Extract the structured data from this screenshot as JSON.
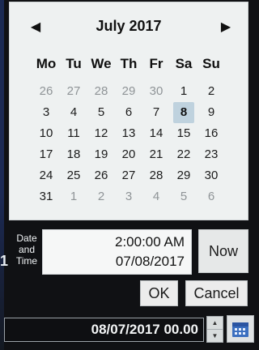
{
  "calendar": {
    "month_title": "July 2017",
    "prev_icon": "◀",
    "next_icon": "▶",
    "weekdays": [
      "Mo",
      "Tu",
      "We",
      "Th",
      "Fr",
      "Sa",
      "Su"
    ],
    "days": [
      {
        "label": "26",
        "muted": true
      },
      {
        "label": "27",
        "muted": true
      },
      {
        "label": "28",
        "muted": true
      },
      {
        "label": "29",
        "muted": true
      },
      {
        "label": "30",
        "muted": true
      },
      {
        "label": "1"
      },
      {
        "label": "2"
      },
      {
        "label": "3"
      },
      {
        "label": "4"
      },
      {
        "label": "5"
      },
      {
        "label": "6"
      },
      {
        "label": "7"
      },
      {
        "label": "8",
        "selected": true
      },
      {
        "label": "9"
      },
      {
        "label": "10"
      },
      {
        "label": "11"
      },
      {
        "label": "12"
      },
      {
        "label": "13"
      },
      {
        "label": "14"
      },
      {
        "label": "15"
      },
      {
        "label": "16"
      },
      {
        "label": "17"
      },
      {
        "label": "18"
      },
      {
        "label": "19"
      },
      {
        "label": "20"
      },
      {
        "label": "21"
      },
      {
        "label": "22"
      },
      {
        "label": "23"
      },
      {
        "label": "24"
      },
      {
        "label": "25"
      },
      {
        "label": "26"
      },
      {
        "label": "27"
      },
      {
        "label": "28"
      },
      {
        "label": "29"
      },
      {
        "label": "30"
      },
      {
        "label": "31"
      },
      {
        "label": "1",
        "muted": true
      },
      {
        "label": "2",
        "muted": true
      },
      {
        "label": "3",
        "muted": true
      },
      {
        "label": "4",
        "muted": true
      },
      {
        "label": "5",
        "muted": true
      },
      {
        "label": "6",
        "muted": true
      }
    ]
  },
  "date_time": {
    "label_line1": "Date",
    "label_line2": "and",
    "label_line3": "Time",
    "time_value": "2:00:00 AM",
    "date_value": "07/08/2017",
    "now_label": "Now"
  },
  "dialog_buttons": {
    "ok_label": "OK",
    "cancel_label": "Cancel"
  },
  "bottom_bar": {
    "left_marker": "1",
    "input_value": "08/07/2017 00.00",
    "spin_up_icon": "▲",
    "spin_down_icon": "▼",
    "calendar_icon": "calendar-icon"
  },
  "colors": {
    "selected_day_bg": "#bfd2de",
    "panel_bg": "#eef1f1",
    "app_bg": "#101114"
  }
}
